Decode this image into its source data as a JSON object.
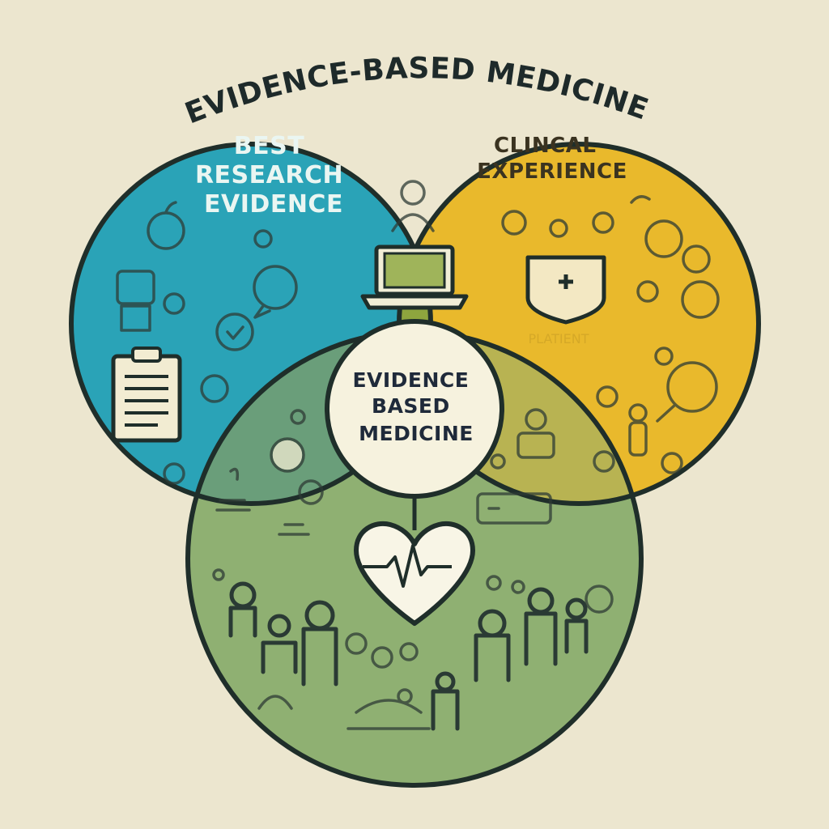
{
  "title": "EVIDENCE-BASED MEDICINE",
  "circles": {
    "research": {
      "lines": [
        "BEST",
        "RESEARCH",
        "EVIDENCE"
      ],
      "color": "#2aa3b7"
    },
    "clinical": {
      "lines": [
        "CLINCAL",
        "EXPERIENCE"
      ],
      "color": "#e9b92c"
    },
    "patient": {
      "color": "#8fb072"
    }
  },
  "faint_text": "PLATIENT",
  "center": {
    "lines": [
      "EVIDENCE",
      "BASED",
      "MEDICINE"
    ],
    "color": "#f6f2de"
  },
  "colors": {
    "background": "#ece6cf",
    "outline": "#1f2e2a",
    "research_clinical_overlap": "#8ea53e",
    "research_patient_overlap": "#6a9e7a",
    "clinical_patient_overlap": "#b8b352"
  },
  "icons": [
    "apple-icon",
    "chat-bubble-icon",
    "check-icon",
    "clipboard-icon",
    "laptop-icon",
    "doctor-icon",
    "medical-cross-shield-icon",
    "magnifier-icon",
    "heart-pulse-icon",
    "people-icon"
  ]
}
